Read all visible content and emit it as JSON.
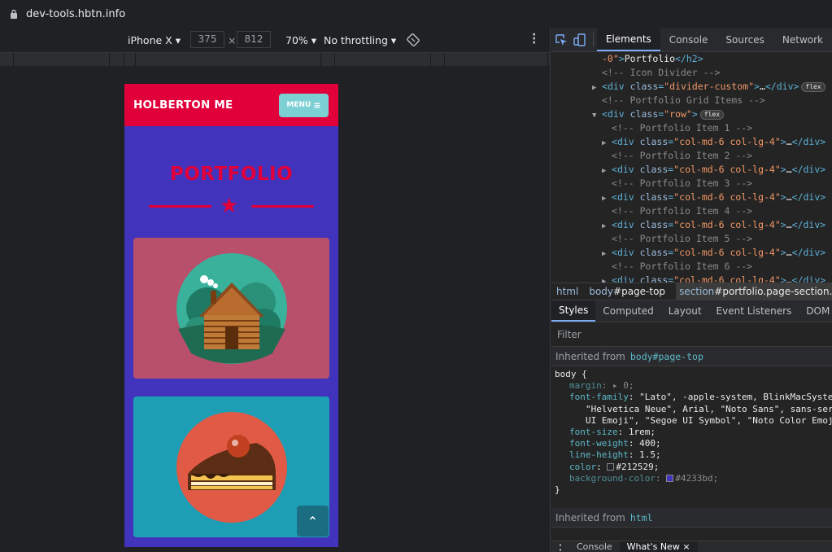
{
  "browser": {
    "url": "dev-tools.hbtn.info"
  },
  "device_toolbar": {
    "device": "iPhone X",
    "width": "375",
    "height": "812",
    "times": "×",
    "zoom": "70%",
    "throttling": "No throttling"
  },
  "site": {
    "brand": "HOLBERTON ME",
    "menu_label": "MENU",
    "menu_icon": "≡",
    "section_title": "PORTFOLIO",
    "divider_icon": "★",
    "scroll_top_icon": "⌃",
    "colors": {
      "primary": "#e2003a",
      "background": "#4233bd",
      "menu": "#7ccfd3",
      "card1": "#b84f6b",
      "card2": "#1e9eb5"
    }
  },
  "devtools": {
    "tabs": [
      "Elements",
      "Console",
      "Sources",
      "Network"
    ],
    "active_tab": "Elements",
    "elements": {
      "h2_tail_value": "-0\"",
      "h2_text": "Portfolio",
      "h2_close": "</h2>",
      "icon_divider_comment": "<!-- Icon Divider -->",
      "divider_tag": "div",
      "divider_attr": "class",
      "divider_value": "\"divider-custom\"",
      "ellipsis": "…",
      "close_div": "</div>",
      "flex_badge": "flex",
      "grid_comment": "<!-- Portfolio Grid Items -->",
      "row_value": "\"row\"",
      "col_value": "\"col-md-6 col-lg-4\"",
      "item_comments": [
        "<!-- Portfolio Item 1 -->",
        "<!-- Portfolio Item 2 -->",
        "<!-- Portfolio Item 3 -->",
        "<!-- Portfolio Item 4 -->",
        "<!-- Portfolio Item 5 -->",
        "<!-- Portfolio Item 6 -->"
      ]
    },
    "breadcrumbs": [
      {
        "tag": "html",
        "rest": ""
      },
      {
        "tag": "body",
        "rest": "#page-top"
      },
      {
        "tag": "section",
        "rest": "#portfolio.page-section.portfolio"
      }
    ],
    "subtabs": [
      "Styles",
      "Computed",
      "Layout",
      "Event Listeners",
      "DOM Breakpoints"
    ],
    "active_subtab": "Styles",
    "filter_placeholder": "Filter",
    "inherited_label": "Inherited from",
    "inherited_body": "body#page-top",
    "inherited_html": "html",
    "rule": {
      "selector": "body {",
      "close": "}",
      "margin_name": "margin",
      "margin_value": "0;",
      "font_family_name": "font-family",
      "font_family_line1": "\"Lato\", -apple-system, BlinkMacSystemFont,",
      "font_family_line2": "\"Helvetica Neue\", Arial, \"Noto Sans\", sans-serif,",
      "font_family_line3": "UI Emoji\", \"Segoe UI Symbol\", \"Noto Color Emoji\";",
      "font_size_name": "font-size",
      "font_size_value": "1rem;",
      "font_weight_name": "font-weight",
      "font_weight_value": "400;",
      "line_height_name": "line-height",
      "line_height_value": "1.5;",
      "color_name": "color",
      "color_value": "#212529;",
      "color_swatch": "#212529",
      "bg_name": "background-color",
      "bg_value": "#4233bd;",
      "bg_swatch": "#4233bd"
    },
    "drawer": {
      "tabs": [
        "Console",
        "What's New"
      ],
      "active": "What's New",
      "close": "×"
    }
  }
}
